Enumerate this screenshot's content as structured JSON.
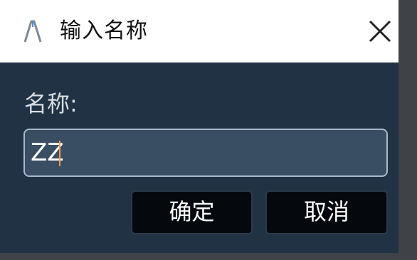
{
  "dialog": {
    "title": "输入名称",
    "name_label": "名称:",
    "name_value": "ZZ",
    "ok_label": "确定",
    "cancel_label": "取消"
  },
  "icons": {
    "app": "app-logo-icon",
    "close": "close-icon"
  },
  "colors": {
    "titlebar_bg": "#ffffff",
    "body_bg": "#203244",
    "input_bg": "#3a4e63",
    "input_border": "#a7b9cc",
    "button_bg": "#05090e"
  }
}
